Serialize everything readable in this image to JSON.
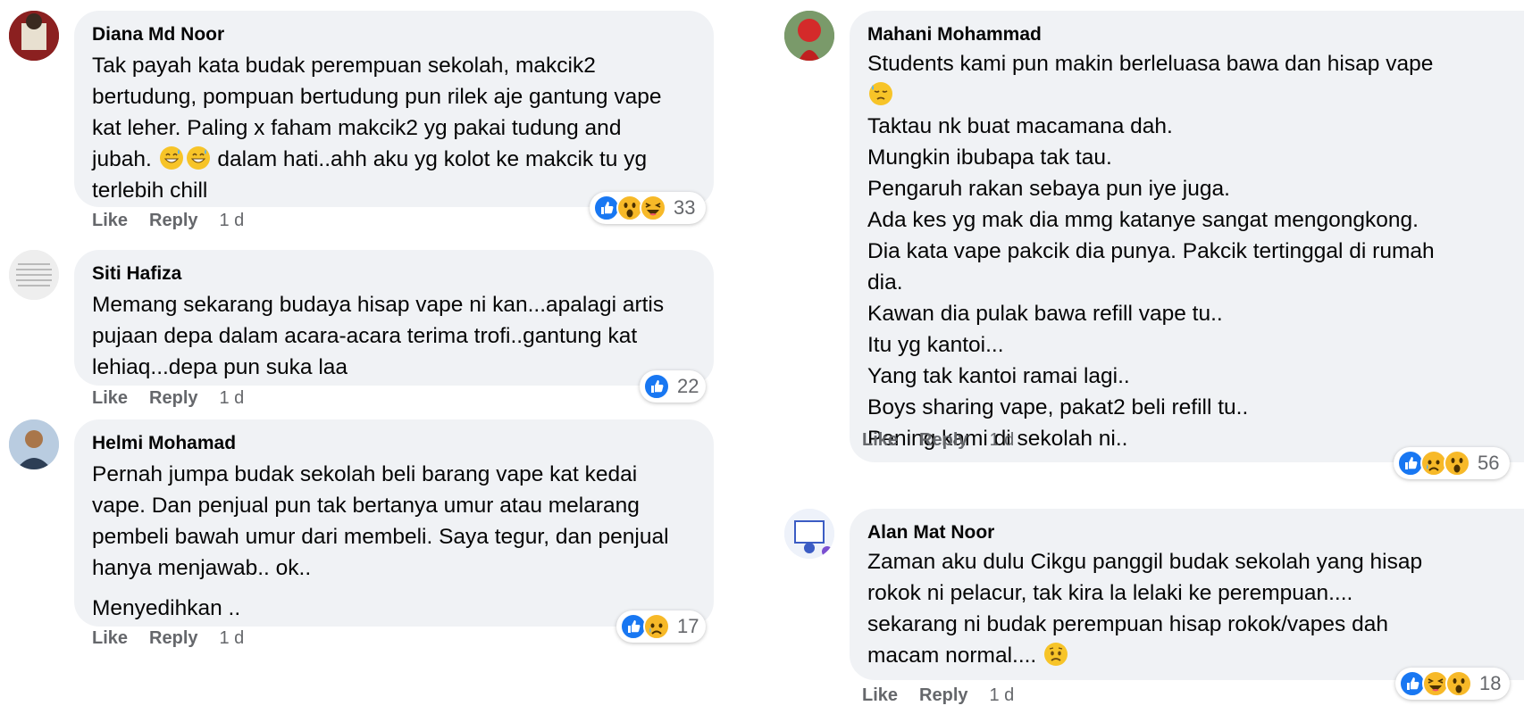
{
  "left_column": [
    {
      "author": "Diana Md Noor",
      "lines": [
        "Tak payah kata budak perempuan sekolah, makcik2",
        "bertudung, pompuan bertudung pun rilek aje gantung vape",
        "kat leher. Paling x faham makcik2 yg pakai tudung and",
        "jubah.",
        "dalam hati..ahh aku yg kolot ke makcik tu yg",
        "terlebih chill"
      ],
      "reactions": [
        "like",
        "wow",
        "haha"
      ],
      "reaction_count": "33",
      "like": "Like",
      "reply": "Reply",
      "time": "1 d"
    },
    {
      "author": "Siti Hafiza",
      "lines": [
        "Memang sekarang budaya hisap vape ni kan...apalagi artis",
        "pujaan depa dalam acara-acara terima trofi..gantung kat",
        "lehiaq...depa pun suka laa"
      ],
      "reactions": [
        "like"
      ],
      "reaction_count": "22",
      "like": "Like",
      "reply": "Reply",
      "time": "1 d"
    },
    {
      "author": "Helmi Mohamad",
      "lines": [
        "Pernah jumpa budak sekolah beli barang vape kat kedai",
        "vape. Dan penjual pun tak bertanya umur atau melarang",
        "pembeli bawah umur dari membeli. Saya tegur, dan penjual",
        "hanya menjawab.. ok.."
      ],
      "extra_line": "Menyedihkan ..",
      "reactions": [
        "like",
        "sad"
      ],
      "reaction_count": "17",
      "like": "Like",
      "reply": "Reply",
      "time": "1 d"
    }
  ],
  "right_column": [
    {
      "author": "Mahani Mohammad",
      "lines": [
        "Students kami pun makin berleluasa bawa dan hisap vape",
        "",
        "Taktau nk buat macamana dah.",
        "Mungkin ibubapa tak tau.",
        "Pengaruh rakan sebaya pun iye juga.",
        "Ada kes yg mak dia mmg katanye sangat mengongkong.",
        "Dia kata vape pakcik dia punya. Pakcik tertinggal di rumah",
        "dia.",
        "Kawan dia pulak bawa refill vape tu..",
        "Itu yg kantoi...",
        "Yang tak kantoi ramai lagi..",
        "Boys sharing vape, pakat2 beli refill tu..",
        "Pening kami di sekolah ni.."
      ],
      "reactions": [
        "like",
        "sad",
        "wow"
      ],
      "reaction_count": "56",
      "like": "Like",
      "reply": "Reply",
      "time": "1 d"
    },
    {
      "author": "Alan Mat Noor",
      "lines": [
        "Zaman aku dulu Cikgu panggil budak sekolah yang hisap",
        "rokok ni pelacur, tak kira la lelaki ke perempuan....",
        "sekarang ni budak perempuan hisap rokok/vapes dah",
        "macam normal...."
      ],
      "reactions": [
        "like",
        "haha",
        "wow"
      ],
      "reaction_count": "18",
      "like": "Like",
      "reply": "Reply",
      "time": "1 d"
    }
  ],
  "colors": {
    "bubble": "#f0f2f5",
    "meta_text": "#65676b",
    "like_blue": "#1877f2",
    "emoji_yellow": "#f7b928"
  }
}
